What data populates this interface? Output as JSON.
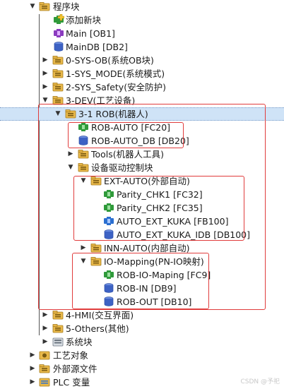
{
  "tree": {
    "program_blocks": "程序块",
    "add_block": "添加新块",
    "main": "Main [OB1]",
    "main_db": "MainDB [DB2]",
    "sys_ob": "0-SYS-OB(系统OB块)",
    "sys_mode": "1-SYS_MODE(系统模式)",
    "sys_safety": "2-SYS_Safety(安全防护)",
    "dev": "3-DEV(工艺设备)",
    "rob": "3-1 ROB(机器人)",
    "rob_auto": "ROB-AUTO [FC20]",
    "rob_auto_db": "ROB-AUTO_DB [DB20]",
    "tools": "Tools(机器人工具)",
    "drive_blocks": "设备驱动控制块",
    "ext_auto": "EXT-AUTO(外部自动)",
    "parity1": "Parity_CHK1 [FC32]",
    "parity2": "Parity_CHK2 [FC35]",
    "auto_ext_kuka": "AUTO_EXT_KUKA [FB100]",
    "auto_ext_kuka_idb": "AUTO_EXT_KUKA_IDB [DB100]",
    "inn_auto": "INN-AUTO(内部自动)",
    "io_mapping": "IO-Mapping(PN-IO映射)",
    "rob_io_maping": "ROB-IO-Maping [FC9]",
    "rob_in": "ROB-IN [DB9]",
    "rob_out": "ROB-OUT [DB10]",
    "hmi": "4-HMI(交互界面)",
    "others": "5-Others(其他)",
    "system_blocks": "系统块",
    "tech_objects": "工艺对象",
    "ext_sources": "外部源文件",
    "plc_vars": "PLC 变量"
  },
  "watermark": "CSDN @予祀",
  "colors": {
    "selection": "#cfe3f7",
    "highlight": "#e03c3c",
    "folder": "#e8b84a",
    "block_green": "#2f9a3a",
    "db_blue": "#3d62c4",
    "ob_purple": "#8b3bbf"
  }
}
